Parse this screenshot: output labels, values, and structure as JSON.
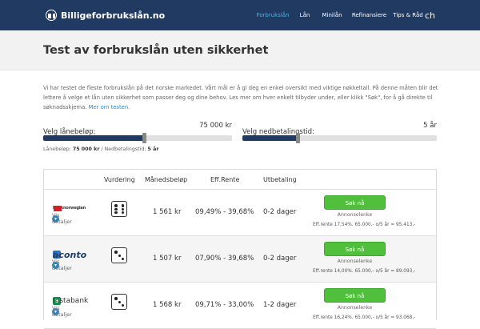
{
  "header": {
    "logo_text": "Billigeforbrukslån.no",
    "nav": [
      "Forbrukslån",
      "Lån",
      "Minilån",
      "Refinansiere",
      "Tips & Råd",
      "ch"
    ]
  },
  "page": {
    "title": "Test av forbrukslån uten sikkerhet",
    "intro": "Vi har testet de fleste forbrukslån på det norske markedet. Vårt mål er å gi deg en enkel oversikt med viktige nøkkeltall. På denne måten blir det lettere å velge et lån uten sikkerhet som passer deg og dine behov. Les mer om hver enkelt tilbyder under, eller klikk \"Søk\", for å gå direkte til søknadsskjema.",
    "intro_link": "Mer om testen."
  },
  "sliders": {
    "amount_label": "Velg lånebeløp:",
    "amount_value": "75 000 kr",
    "amount_fraction": 0.54,
    "term_label": "Velg nedbetalingstid:",
    "term_value": "5 år",
    "term_fraction": 0.29
  },
  "summary": {
    "amount_label": "Lånebeløp:",
    "amount_value": "75 000 kr",
    "sep": "/",
    "term_label": "Nedbetalingstid:",
    "term_value": "5 år"
  },
  "table": {
    "headers": [
      "Vurdering",
      "Månedsbeløp",
      "Eff.Rente",
      "Utbetaling"
    ],
    "rows": [
      {
        "lender": "banknorwegian",
        "details": "Vis detaljer",
        "rating": 4,
        "monthly": "1 561 kr",
        "rate": "09,49% - 39,68%",
        "payout": "0-2 dager",
        "button": "Søk nå",
        "annonse": "Annonselenke",
        "eff": "Eff.rente 17,54%. 65.000,- o/5 år = 95.413,-"
      },
      {
        "lender": "aconto",
        "details": "Vis detaljer",
        "rating": 3,
        "monthly": "1 507 kr",
        "rate": "07,90% - 39,68%",
        "payout": "0-2 dager",
        "button": "Søk nå",
        "annonse": "Annonselenke",
        "eff": "Eff.rente 14,00%. 65.000,- o/5 år = 89.093,-"
      },
      {
        "lender": "Instabank",
        "details": "Vis detaljer",
        "rating": 3,
        "monthly": "1 568 kr",
        "rate": "09,71% - 33,00%",
        "payout": "1-2 dager",
        "button": "Søk nå",
        "annonse": "Annonselenke",
        "eff": "Eff.rente 16,24%. 65.000,- o/5 år = 93.068,-"
      }
    ]
  }
}
